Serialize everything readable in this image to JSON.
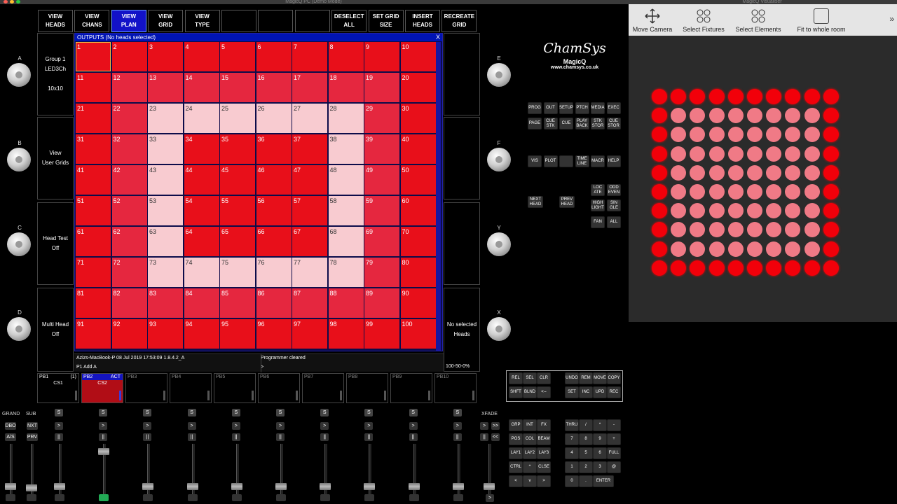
{
  "window_title": "MagicQ PC (Demo Mode)",
  "visualiser_title": "MagicQ Visualiser",
  "top_buttons": [
    {
      "label": "VIEW\nHEADS",
      "active": false
    },
    {
      "label": "VIEW\nCHANS",
      "active": false
    },
    {
      "label": "VIEW\nPLAN",
      "active": true
    },
    {
      "label": "VIEW\nGRID",
      "active": false
    },
    {
      "label": "VIEW\nTYPE",
      "active": false
    },
    {
      "label": "",
      "active": false
    },
    {
      "label": "",
      "active": false
    },
    {
      "label": "",
      "active": false
    },
    {
      "label": "DESELECT\nALL",
      "active": false
    },
    {
      "label": "SET GRID\nSIZE",
      "active": false
    },
    {
      "label": "INSERT\nHEADS",
      "active": false
    },
    {
      "label": "RECREATE\nGRID",
      "active": false
    }
  ],
  "encoders_left": [
    {
      "letter": "A",
      "text": "Group 1\nLED3Ch\n\n10x10"
    },
    {
      "letter": "B",
      "text": "View\nUser Grids"
    },
    {
      "letter": "C",
      "text": "Head Test\nOff"
    },
    {
      "letter": "D",
      "text": "Multi Head\nOff"
    }
  ],
  "encoders_right": [
    {
      "letter": "E",
      "text": ""
    },
    {
      "letter": "F",
      "text": ""
    },
    {
      "letter": "Y",
      "text": ""
    },
    {
      "letter": "X",
      "text": "No selected\nHeads"
    }
  ],
  "outputs": {
    "title": "OUTPUTS (No heads selected)",
    "close": "X",
    "cells": [
      {
        "n": "1",
        "c": "red"
      },
      {
        "n": "2",
        "c": "red"
      },
      {
        "n": "3",
        "c": "red"
      },
      {
        "n": "4",
        "c": "red"
      },
      {
        "n": "5",
        "c": "red"
      },
      {
        "n": "6",
        "c": "red"
      },
      {
        "n": "7",
        "c": "red"
      },
      {
        "n": "8",
        "c": "red"
      },
      {
        "n": "9",
        "c": "red"
      },
      {
        "n": "10",
        "c": "red"
      },
      {
        "n": "11",
        "c": "red"
      },
      {
        "n": "12",
        "c": "mid"
      },
      {
        "n": "13",
        "c": "mid"
      },
      {
        "n": "14",
        "c": "mid"
      },
      {
        "n": "15",
        "c": "mid"
      },
      {
        "n": "16",
        "c": "mid"
      },
      {
        "n": "17",
        "c": "mid"
      },
      {
        "n": "18",
        "c": "mid"
      },
      {
        "n": "19",
        "c": "mid"
      },
      {
        "n": "20",
        "c": "red"
      },
      {
        "n": "21",
        "c": "red"
      },
      {
        "n": "22",
        "c": "mid"
      },
      {
        "n": "23",
        "c": "pink"
      },
      {
        "n": "24",
        "c": "pink"
      },
      {
        "n": "25",
        "c": "pink"
      },
      {
        "n": "26",
        "c": "pink"
      },
      {
        "n": "27",
        "c": "pink"
      },
      {
        "n": "28",
        "c": "pink"
      },
      {
        "n": "29",
        "c": "mid"
      },
      {
        "n": "30",
        "c": "red"
      },
      {
        "n": "31",
        "c": "red"
      },
      {
        "n": "32",
        "c": "mid"
      },
      {
        "n": "33",
        "c": "pink"
      },
      {
        "n": "34",
        "c": "red"
      },
      {
        "n": "35",
        "c": "red"
      },
      {
        "n": "36",
        "c": "red"
      },
      {
        "n": "37",
        "c": "red"
      },
      {
        "n": "38",
        "c": "pink"
      },
      {
        "n": "39",
        "c": "mid"
      },
      {
        "n": "40",
        "c": "red"
      },
      {
        "n": "41",
        "c": "red"
      },
      {
        "n": "42",
        "c": "mid"
      },
      {
        "n": "43",
        "c": "pink"
      },
      {
        "n": "44",
        "c": "red"
      },
      {
        "n": "45",
        "c": "red"
      },
      {
        "n": "46",
        "c": "red"
      },
      {
        "n": "47",
        "c": "red"
      },
      {
        "n": "48",
        "c": "pink"
      },
      {
        "n": "49",
        "c": "mid"
      },
      {
        "n": "50",
        "c": "red"
      },
      {
        "n": "51",
        "c": "red"
      },
      {
        "n": "52",
        "c": "mid"
      },
      {
        "n": "53",
        "c": "pink"
      },
      {
        "n": "54",
        "c": "red"
      },
      {
        "n": "55",
        "c": "red"
      },
      {
        "n": "56",
        "c": "red"
      },
      {
        "n": "57",
        "c": "red"
      },
      {
        "n": "58",
        "c": "pink"
      },
      {
        "n": "59",
        "c": "mid"
      },
      {
        "n": "60",
        "c": "red"
      },
      {
        "n": "61",
        "c": "red"
      },
      {
        "n": "62",
        "c": "mid"
      },
      {
        "n": "63",
        "c": "pink"
      },
      {
        "n": "64",
        "c": "red"
      },
      {
        "n": "65",
        "c": "red"
      },
      {
        "n": "66",
        "c": "red"
      },
      {
        "n": "67",
        "c": "red"
      },
      {
        "n": "68",
        "c": "pink"
      },
      {
        "n": "69",
        "c": "mid"
      },
      {
        "n": "70",
        "c": "red"
      },
      {
        "n": "71",
        "c": "red"
      },
      {
        "n": "72",
        "c": "mid"
      },
      {
        "n": "73",
        "c": "pink"
      },
      {
        "n": "74",
        "c": "pink"
      },
      {
        "n": "75",
        "c": "pink"
      },
      {
        "n": "76",
        "c": "pink"
      },
      {
        "n": "77",
        "c": "pink"
      },
      {
        "n": "78",
        "c": "pink"
      },
      {
        "n": "79",
        "c": "mid"
      },
      {
        "n": "80",
        "c": "red"
      },
      {
        "n": "81",
        "c": "red"
      },
      {
        "n": "82",
        "c": "mid"
      },
      {
        "n": "83",
        "c": "mid"
      },
      {
        "n": "84",
        "c": "mid"
      },
      {
        "n": "85",
        "c": "mid"
      },
      {
        "n": "86",
        "c": "mid"
      },
      {
        "n": "87",
        "c": "mid"
      },
      {
        "n": "88",
        "c": "mid"
      },
      {
        "n": "89",
        "c": "mid"
      },
      {
        "n": "90",
        "c": "red"
      },
      {
        "n": "91",
        "c": "red"
      },
      {
        "n": "92",
        "c": "red"
      },
      {
        "n": "93",
        "c": "red"
      },
      {
        "n": "94",
        "c": "red"
      },
      {
        "n": "95",
        "c": "red"
      },
      {
        "n": "96",
        "c": "red"
      },
      {
        "n": "97",
        "c": "red"
      },
      {
        "n": "98",
        "c": "red"
      },
      {
        "n": "99",
        "c": "red"
      },
      {
        "n": "100",
        "c": "red"
      }
    ]
  },
  "status": {
    "info": "Azizs-MacBook-P 08 Jul 2019 17:53:09 1.8.4.2_A",
    "message": "Programmer cleared",
    "cmd": "P1  Add A",
    "prompt": ">",
    "levels": "100-50-0%"
  },
  "playbacks": [
    {
      "name": "PB1",
      "num": "(1)",
      "cue": "CS1",
      "active": false,
      "tag": ""
    },
    {
      "name": "PB2",
      "num": "",
      "cue": "CS2",
      "active": true,
      "tag": "ACT"
    },
    {
      "name": "PB3",
      "num": "",
      "cue": "",
      "active": false,
      "tag": ""
    },
    {
      "name": "PB4",
      "num": "",
      "cue": "",
      "active": false,
      "tag": ""
    },
    {
      "name": "PB5",
      "num": "",
      "cue": "",
      "active": false,
      "tag": ""
    },
    {
      "name": "PB6",
      "num": "",
      "cue": "",
      "active": false,
      "tag": ""
    },
    {
      "name": "PB7",
      "num": "",
      "cue": "",
      "active": false,
      "tag": ""
    },
    {
      "name": "PB8",
      "num": "",
      "cue": "",
      "active": false,
      "tag": ""
    },
    {
      "name": "PB9",
      "num": "",
      "cue": "",
      "active": false,
      "tag": ""
    },
    {
      "name": "PB10",
      "num": "",
      "cue": "",
      "active": false,
      "tag": ""
    }
  ],
  "fader_area": {
    "grand": "GRAND",
    "sub": "SUB",
    "xfade": "XFADE",
    "left_buttons": [
      "DBO",
      "NXT",
      "A/S",
      "PRV"
    ],
    "s": "S",
    "go": ">",
    "pause": "||",
    "ff": ">>",
    "rw": "<<"
  },
  "logo": {
    "brand": "ChamSys",
    "product": "MagicQ",
    "url": "www.chamsys.co.uk"
  },
  "keys_window": [
    [
      "PROG",
      "OUT",
      "SETUP",
      "PTCH",
      "MEDIA",
      "EXEC"
    ],
    [
      "PAGE",
      "CUE\nSTK",
      "CUE",
      "PLAY\nBACK",
      "STK\nSTOR",
      "CUE\nSTOR"
    ]
  ],
  "keys_window2": [
    "VIS",
    "PLOT",
    "",
    "TIME\nLINE",
    "MACR",
    "HELP"
  ],
  "keys_sel": [
    "NEXT\nHEAD",
    "PREV\nHEAD",
    "LOC\nATE",
    "ODD\nEVEN",
    "HIGH\nLIGHT",
    "SIN\nGLE",
    "FAN",
    "ALL"
  ],
  "keys_prog": [
    [
      "REL",
      "SEL",
      "CLR",
      "",
      "UNDO",
      "REM",
      "MOVE",
      "COPY"
    ],
    [
      "SHFT",
      "BLND",
      "<--",
      "",
      "SET",
      "INC",
      "UPD",
      "REC"
    ]
  ],
  "keypad_left": [
    [
      "GRP",
      "INT",
      "FX"
    ],
    [
      "POS",
      "COL",
      "BEAM"
    ],
    [
      "LAY1",
      "LAY2",
      "LAY3"
    ],
    [
      "CTRL",
      "^",
      "CLSE"
    ],
    [
      "<",
      "v",
      ">"
    ]
  ],
  "keypad_right": [
    [
      "THRU",
      "/",
      "*",
      "-"
    ],
    [
      "7",
      "8",
      "9",
      "+"
    ],
    [
      "4",
      "5",
      "6",
      "FULL"
    ],
    [
      "1",
      "2",
      "3",
      "@"
    ],
    [
      "0",
      ".",
      "ENTER",
      ""
    ]
  ],
  "visualiser": {
    "tools": [
      "Move Camera",
      "Select Fixtures",
      "Select Elements",
      "Fit to whole room"
    ],
    "more": "»",
    "dots": [
      "rrrrrrrrrr",
      "rppppppppr",
      "rppppppppr",
      "rppppppppr",
      "rppppppppr",
      "rppppppppr",
      "rppppppppr",
      "rppppppppr",
      "rppppppppr",
      "rrrrrrrrrr"
    ]
  },
  "colors": {
    "red": "#e80f1a",
    "mid": "#e5273f",
    "pink": "#f8cbd0",
    "active_blue": "#1212c8"
  }
}
